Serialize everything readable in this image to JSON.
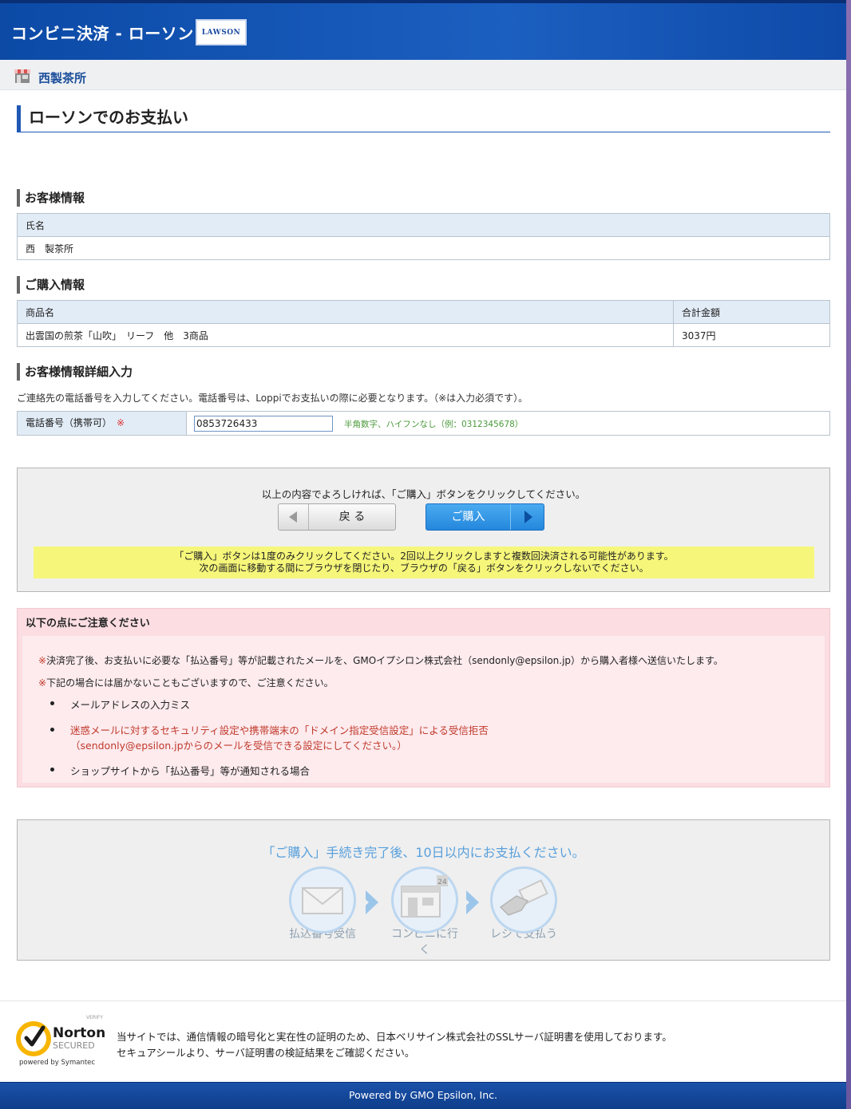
{
  "header": {
    "title": "コンビニ決済 - ローソン",
    "logo_text": "LAWSON"
  },
  "shop": {
    "name": "西製茶所"
  },
  "page_title": "ローソンでのお支払い",
  "customer": {
    "section_title": "お客様情報",
    "name_label": "氏名",
    "name_value": "西　製茶所"
  },
  "purchase": {
    "section_title": "ご購入情報",
    "col_product": "商品名",
    "col_total": "合計金額",
    "product": "出雲国の煎茶「山吹」　リーフ　他　3商品",
    "total": "3037円"
  },
  "detail": {
    "section_title": "お客様情報詳細入力",
    "description": "ご連絡先の電話番号を入力してください。電話番号は、Loppiでお支払いの際に必要となります。（※は入力必須です）。",
    "phone_label": "電話番号（携帯可）",
    "required_mark": "※",
    "phone_value": "0853726433",
    "phone_hint": "半角数字、ハイフンなし（例：0312345678）"
  },
  "confirm": {
    "message": "以上の内容でよろしければ、「ご購入」ボタンをクリックしてください。",
    "back_label": "戻 る",
    "buy_label": "ご購入",
    "warning_line1": "「ご購入」ボタンは1度のみクリックしてください。2回以上クリックしますと複数回決済される可能性があります。",
    "warning_line2": "次の画面に移動する間にブラウザを閉じたり、ブラウザの「戻る」ボタンをクリックしないでください。"
  },
  "notice": {
    "title": "以下の点にご注意ください",
    "line1_mark": "※",
    "line1": "決済完了後、お支払いに必要な「払込番号」等が記載されたメールを、GMOイプシロン株式会社（sendonly@epsilon.jp）から購入者様へ送信いたします。",
    "line2_mark": "※",
    "line2": "下記の場合には届かないこともございますので、ご注意ください。",
    "items": [
      "メールアドレスの入力ミス",
      "迷惑メールに対するセキュリティ設定や携帯端末の「ドメイン指定受信設定」による受信拒否",
      "（sendonly@epsilon.jpからのメールを受信できる設定にしてください。）",
      "ショップサイトから「払込番号」等が通知される場合"
    ]
  },
  "flow": {
    "title": "「ご購入」手続き完了後、10日以内にお支払ください。",
    "steps": [
      "払込番号受信",
      "コンビニに行く",
      "レジで支払う"
    ],
    "store_badge": "24"
  },
  "seal": {
    "verify": "VERIFY",
    "brand": "Norton",
    "secured": "SECURED",
    "powered": "powered by Symantec",
    "text1": "当サイトでは、通信情報の暗号化と実在性の証明のため、日本ベリサイン株式会社のSSLサーバ証明書を使用しております。",
    "text2": "セキュアシールより、サーバ証明書の検証結果をご確認ください。"
  },
  "footer": {
    "text": "Powered by GMO Epsilon, Inc."
  },
  "colors": {
    "header_blue": "#1b5fc0",
    "accent_blue": "#1f58b5",
    "buy_button": "#2487dc",
    "warning_yellow": "#f6f77a",
    "notice_pink": "#fbdde2"
  }
}
